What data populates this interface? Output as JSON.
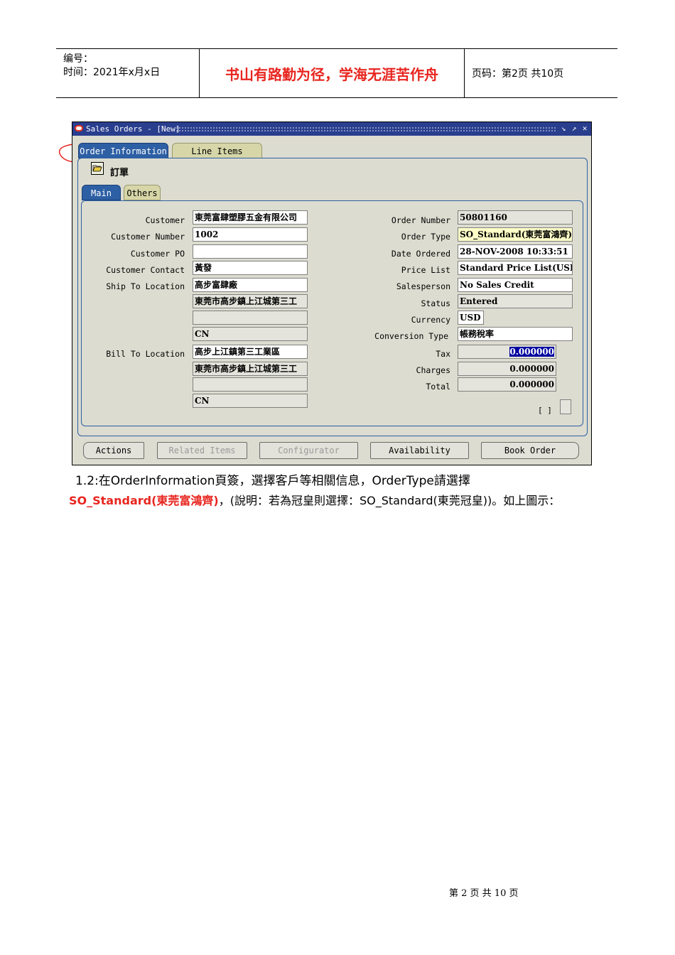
{
  "header": {
    "number_label": "编号：",
    "time_label": "时间：2021年x月x日",
    "motto": "书山有路勤为径，学海无涯苦作舟",
    "page_info": "页码：第2页  共10页"
  },
  "window": {
    "title": "Sales Orders - [New]",
    "controls": [
      "minimize-icon",
      "maximize-icon",
      "close-icon"
    ],
    "tabs": [
      {
        "label": "Order Information",
        "active": true
      },
      {
        "label": "Line Items",
        "active": false
      }
    ],
    "section_title": "訂單",
    "subtabs": [
      {
        "label": "Main",
        "active": true
      },
      {
        "label": "Others",
        "active": false
      }
    ],
    "left_fields": {
      "customer": {
        "label": "Customer",
        "value": "東莞富肆塑膠五金有限公司"
      },
      "customer_number": {
        "label": "Customer Number",
        "value": "1002"
      },
      "customer_po": {
        "label": "Customer PO",
        "value": ""
      },
      "customer_contact": {
        "label": "Customer Contact",
        "value": "黃發"
      },
      "ship_to": {
        "label": "Ship To Location",
        "lines": [
          "高步富肆廠",
          "東莞市高步鎮上江城第三工",
          "",
          "CN"
        ]
      },
      "bill_to": {
        "label": "Bill To Location",
        "lines": [
          "高步上江鎮第三工業區",
          "東莞市高步鎮上江城第三工",
          "",
          "CN"
        ]
      }
    },
    "right_fields": {
      "order_number": {
        "label": "Order Number",
        "value": "50801160"
      },
      "order_type": {
        "label": "Order Type",
        "value": "SO_Standard(東莞富鴻齊)"
      },
      "date_ordered": {
        "label": "Date Ordered",
        "value": "28-NOV-2008 10:33:51"
      },
      "price_list": {
        "label": "Price List",
        "value": "Standard Price List(USD)"
      },
      "salesperson": {
        "label": "Salesperson",
        "value": "No Sales Credit"
      },
      "status": {
        "label": "Status",
        "value": "Entered"
      },
      "currency": {
        "label": "Currency",
        "value": "USD"
      },
      "conversion_type": {
        "label": "Conversion Type",
        "value": "帳務稅率"
      },
      "tax": {
        "label": "Tax",
        "value": "0.000000"
      },
      "charges": {
        "label": "Charges",
        "value": "0.000000"
      },
      "total": {
        "label": "Total",
        "value": "0.000000"
      },
      "flex": "[ ]"
    },
    "buttons": [
      {
        "label": "Actions",
        "enabled": true
      },
      {
        "label": "Related Items",
        "enabled": false
      },
      {
        "label": "Configurator",
        "enabled": false
      },
      {
        "label": "Availability",
        "enabled": true
      },
      {
        "label": "Book Order",
        "enabled": true
      }
    ]
  },
  "body": {
    "para1": "1.2:在OrderInformation頁簽，選擇客戶等相關信息，OrderType請選擇",
    "para2_highlight": "SO_Standard(東莞富鴻齊)",
    "para2_rest": "，(說明：若為冠皇則選擇：SO_Standard(東莞冠皇))。如上圖示："
  },
  "footer": {
    "text": "第 2 页 共 10 页"
  }
}
